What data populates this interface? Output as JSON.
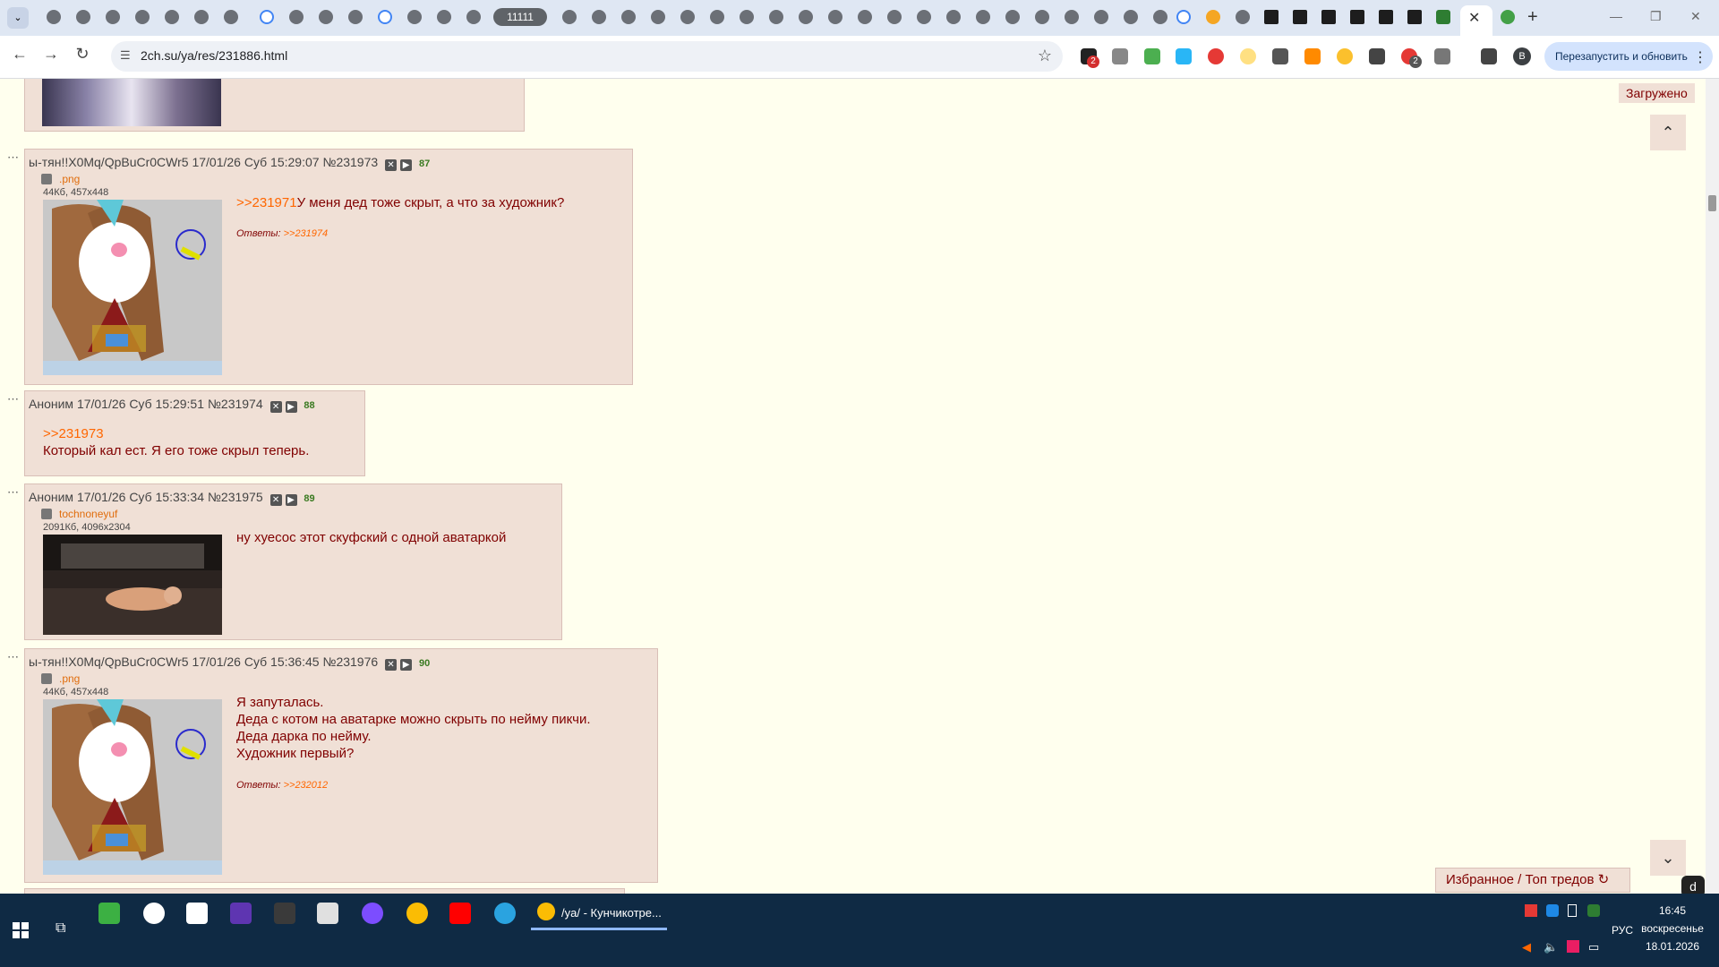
{
  "browser": {
    "tab_group_label": "11111",
    "url": "2ch.su/ya/res/231886.html",
    "relaunch_label": "Перезапустить и обновить",
    "profile_initial": "B",
    "ext_badge_1": "2",
    "ext_badge_2": "2"
  },
  "page": {
    "loaded_label": "Загружено",
    "favorites_label": "Избранное / Топ тредов",
    "posts": [
      {
        "author": "ы-тян!!X0Mq/QpBuCr0CWr5",
        "date": "17/01/26 Суб 15:29:07",
        "num": "№231973",
        "count": "87",
        "file_name": ".png",
        "file_size": "44Кб, 457x448",
        "reply_to": ">>231971",
        "text": "У меня дед тоже скрыт, а что за художник?",
        "replies_label": "Ответы:",
        "replies": ">>231974"
      },
      {
        "author": "Аноним",
        "date": "17/01/26 Суб 15:29:51",
        "num": "№231974",
        "count": "88",
        "reply_to": ">>231973",
        "text": "Который кал ест. Я его тоже скрыл теперь."
      },
      {
        "author": "Аноним",
        "date": "17/01/26 Суб 15:33:34",
        "num": "№231975",
        "count": "89",
        "file_name": "tochnoneyuf",
        "file_size": "2091Кб, 4096x2304",
        "text": "ну хуесос этот скуфский с одной аватаркой"
      },
      {
        "author": "ы-тян!!X0Mq/QpBuCr0CWr5",
        "date": "17/01/26 Суб 15:36:45",
        "num": "№231976",
        "count": "90",
        "file_name": ".png",
        "file_size": "44Кб, 457x448",
        "lines": [
          "Я запуталась.",
          "Деда с котом на аватарке можно скрыть по нейму пикчи.",
          "Деда дарка по нейму.",
          "Художник первый?"
        ],
        "replies_label": "Ответы:",
        "replies": ">>232012"
      }
    ]
  },
  "taskbar": {
    "active_window": "/ya/ - Кунчикотре...",
    "time": "16:45",
    "weekday": "воскресенье",
    "date": "18.01.2026",
    "lang": "РУС"
  },
  "colors": {
    "post_bg": "#f0e0d6",
    "page_bg": "#ffffee",
    "text": "#800000",
    "link": "#ff6600",
    "taskbar": "#0f2a44"
  }
}
